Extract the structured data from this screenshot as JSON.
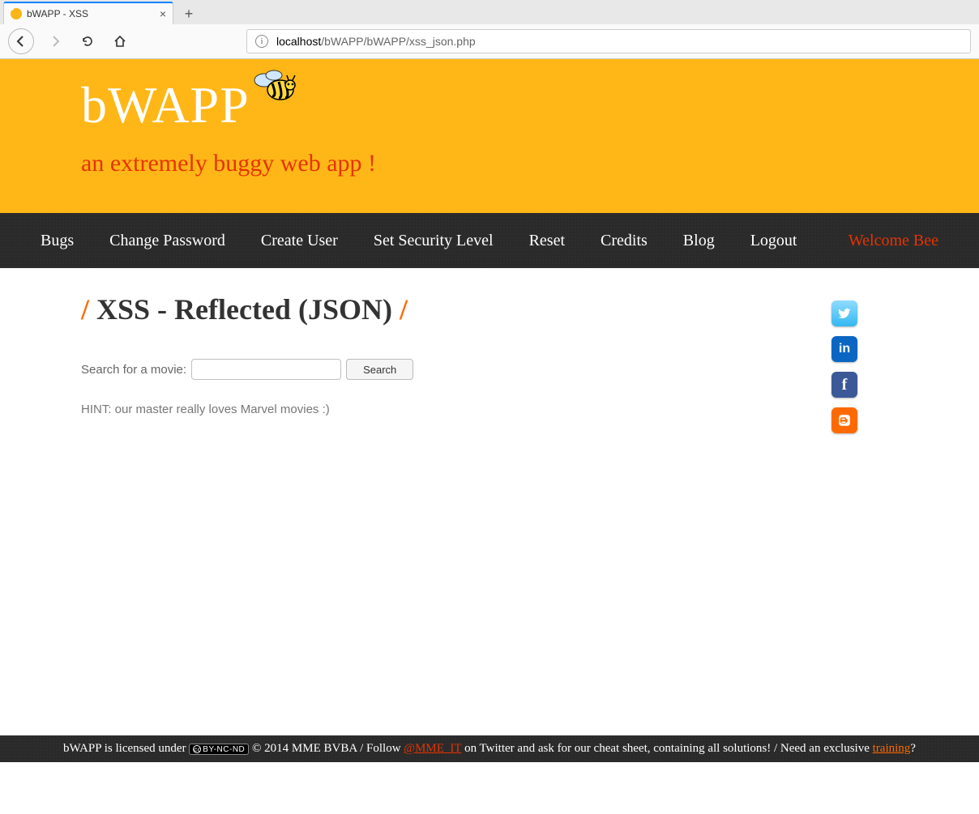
{
  "browser": {
    "tab_title": "bWAPP - XSS",
    "url_host": "localhost",
    "url_path": "/bWAPP/bWAPP/xss_json.php"
  },
  "header": {
    "logo_text": "bWAPP",
    "tagline": "an extremely buggy web app !"
  },
  "nav": {
    "items": [
      "Bugs",
      "Change Password",
      "Create User",
      "Set Security Level",
      "Reset",
      "Credits",
      "Blog",
      "Logout"
    ],
    "welcome": "Welcome Bee"
  },
  "main": {
    "title_core": "XSS - Reflected (JSON)",
    "search_label": "Search for a movie:",
    "search_value": "",
    "search_button": "Search",
    "hint": "HINT: our master really loves Marvel movies :)"
  },
  "social": {
    "twitter_name": "twitter-icon",
    "linkedin_name": "linkedin-icon",
    "facebook_name": "facebook-icon",
    "blogger_name": "blogger-icon"
  },
  "footer": {
    "pre": "bWAPP is licensed under ",
    "cc_text": "BY-NC-ND",
    "mid1": " © 2014 MME BVBA / Follow ",
    "mme_link": "@MME_IT",
    "mid2": " on Twitter and ask for our cheat sheet, containing all solutions! / Need an exclusive ",
    "training_link": "training",
    "tail": "?"
  }
}
